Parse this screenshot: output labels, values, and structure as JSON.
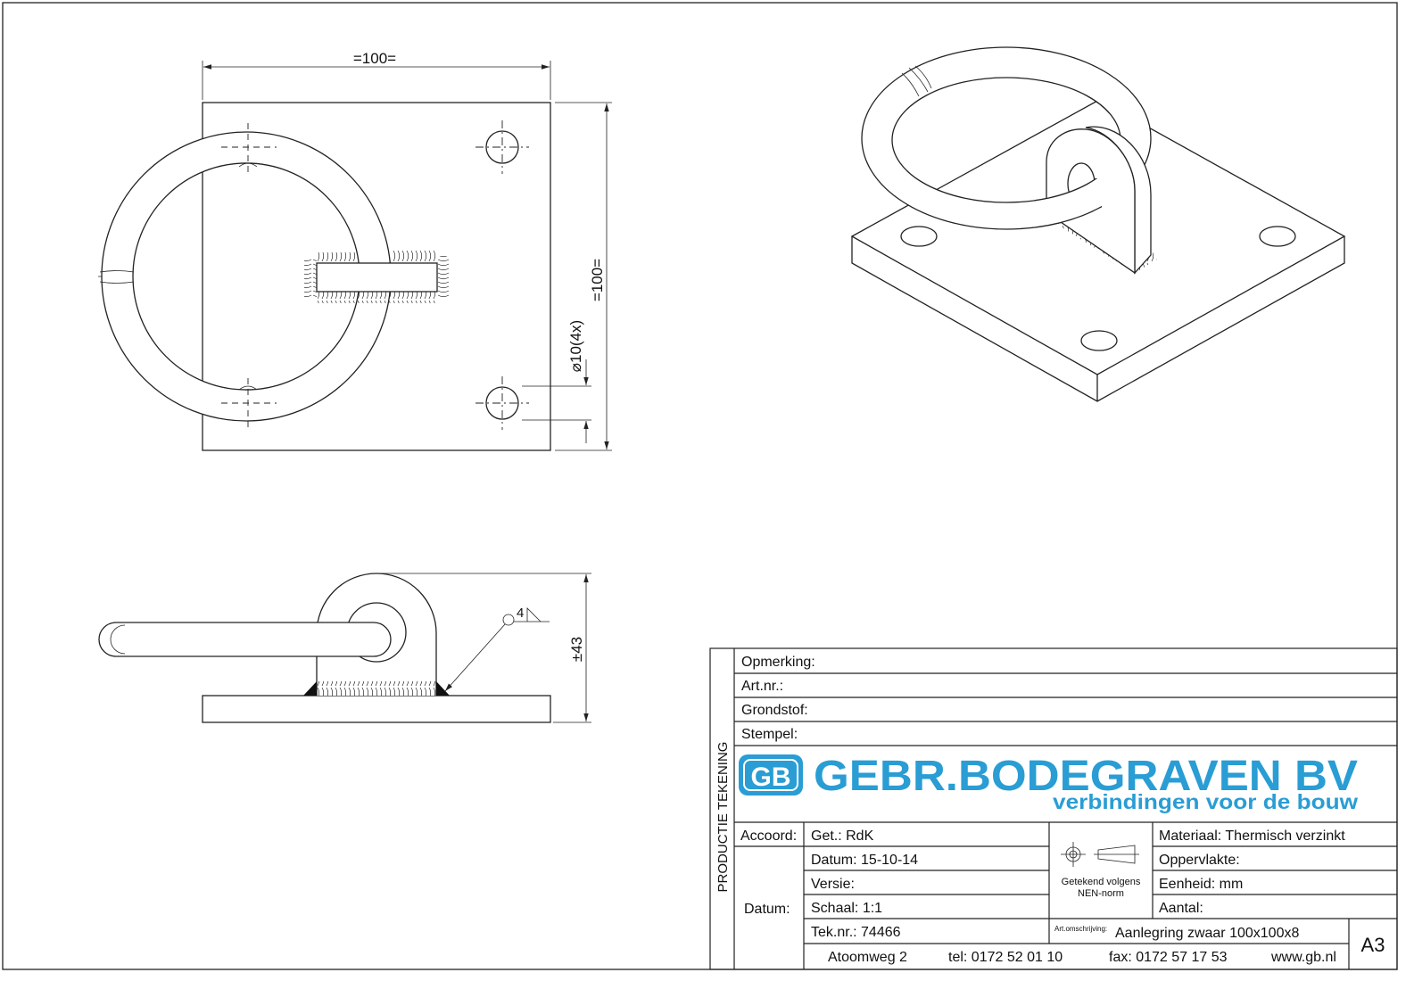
{
  "drawing": {
    "top_view": {
      "width_dim": "=100=",
      "height_dim": "=100=",
      "hole_dim": "⌀10(4x)"
    },
    "side_view": {
      "height_dim": "±43",
      "weld_size": "4"
    }
  },
  "title_block": {
    "vertical_label": "PRODUCTIE TEKENING",
    "opmerking": "Opmerking:",
    "art_nr": "Art.nr.:",
    "grondstof": "Grondstof:",
    "stempel": "Stempel:",
    "logo": {
      "icon_text": "GB",
      "company": "GEBR.BODEGRAVEN BV",
      "tagline": "verbindingen voor de bouw"
    },
    "accoord": "Accoord:",
    "datum_label": "Datum:",
    "get": "Get.: RdK",
    "datum": "Datum: 15-10-14",
    "versie": "Versie:",
    "schaal": "Schaal: 1:1",
    "tek_nr": "Tek.nr.: 74466",
    "norm_line1": "Getekend volgens",
    "norm_line2": "NEN-norm",
    "materiaal": "Materiaal: Thermisch verzinkt",
    "oppervlakte": "Oppervlakte:",
    "eenheid": "Eenheid: mm",
    "aantal": "Aantal:",
    "art_omschrijving_label": "Art.omschrijving:",
    "art_omschrijving": "Aanlegring zwaar 100x100x8",
    "format": "A3",
    "address": "Atoomweg 2",
    "tel": "tel: 0172 52 01 10",
    "fax": "fax: 0172 57 17 53",
    "web": "www.gb.nl"
  },
  "colors": {
    "brand": "#299dd4",
    "line": "#222222"
  }
}
